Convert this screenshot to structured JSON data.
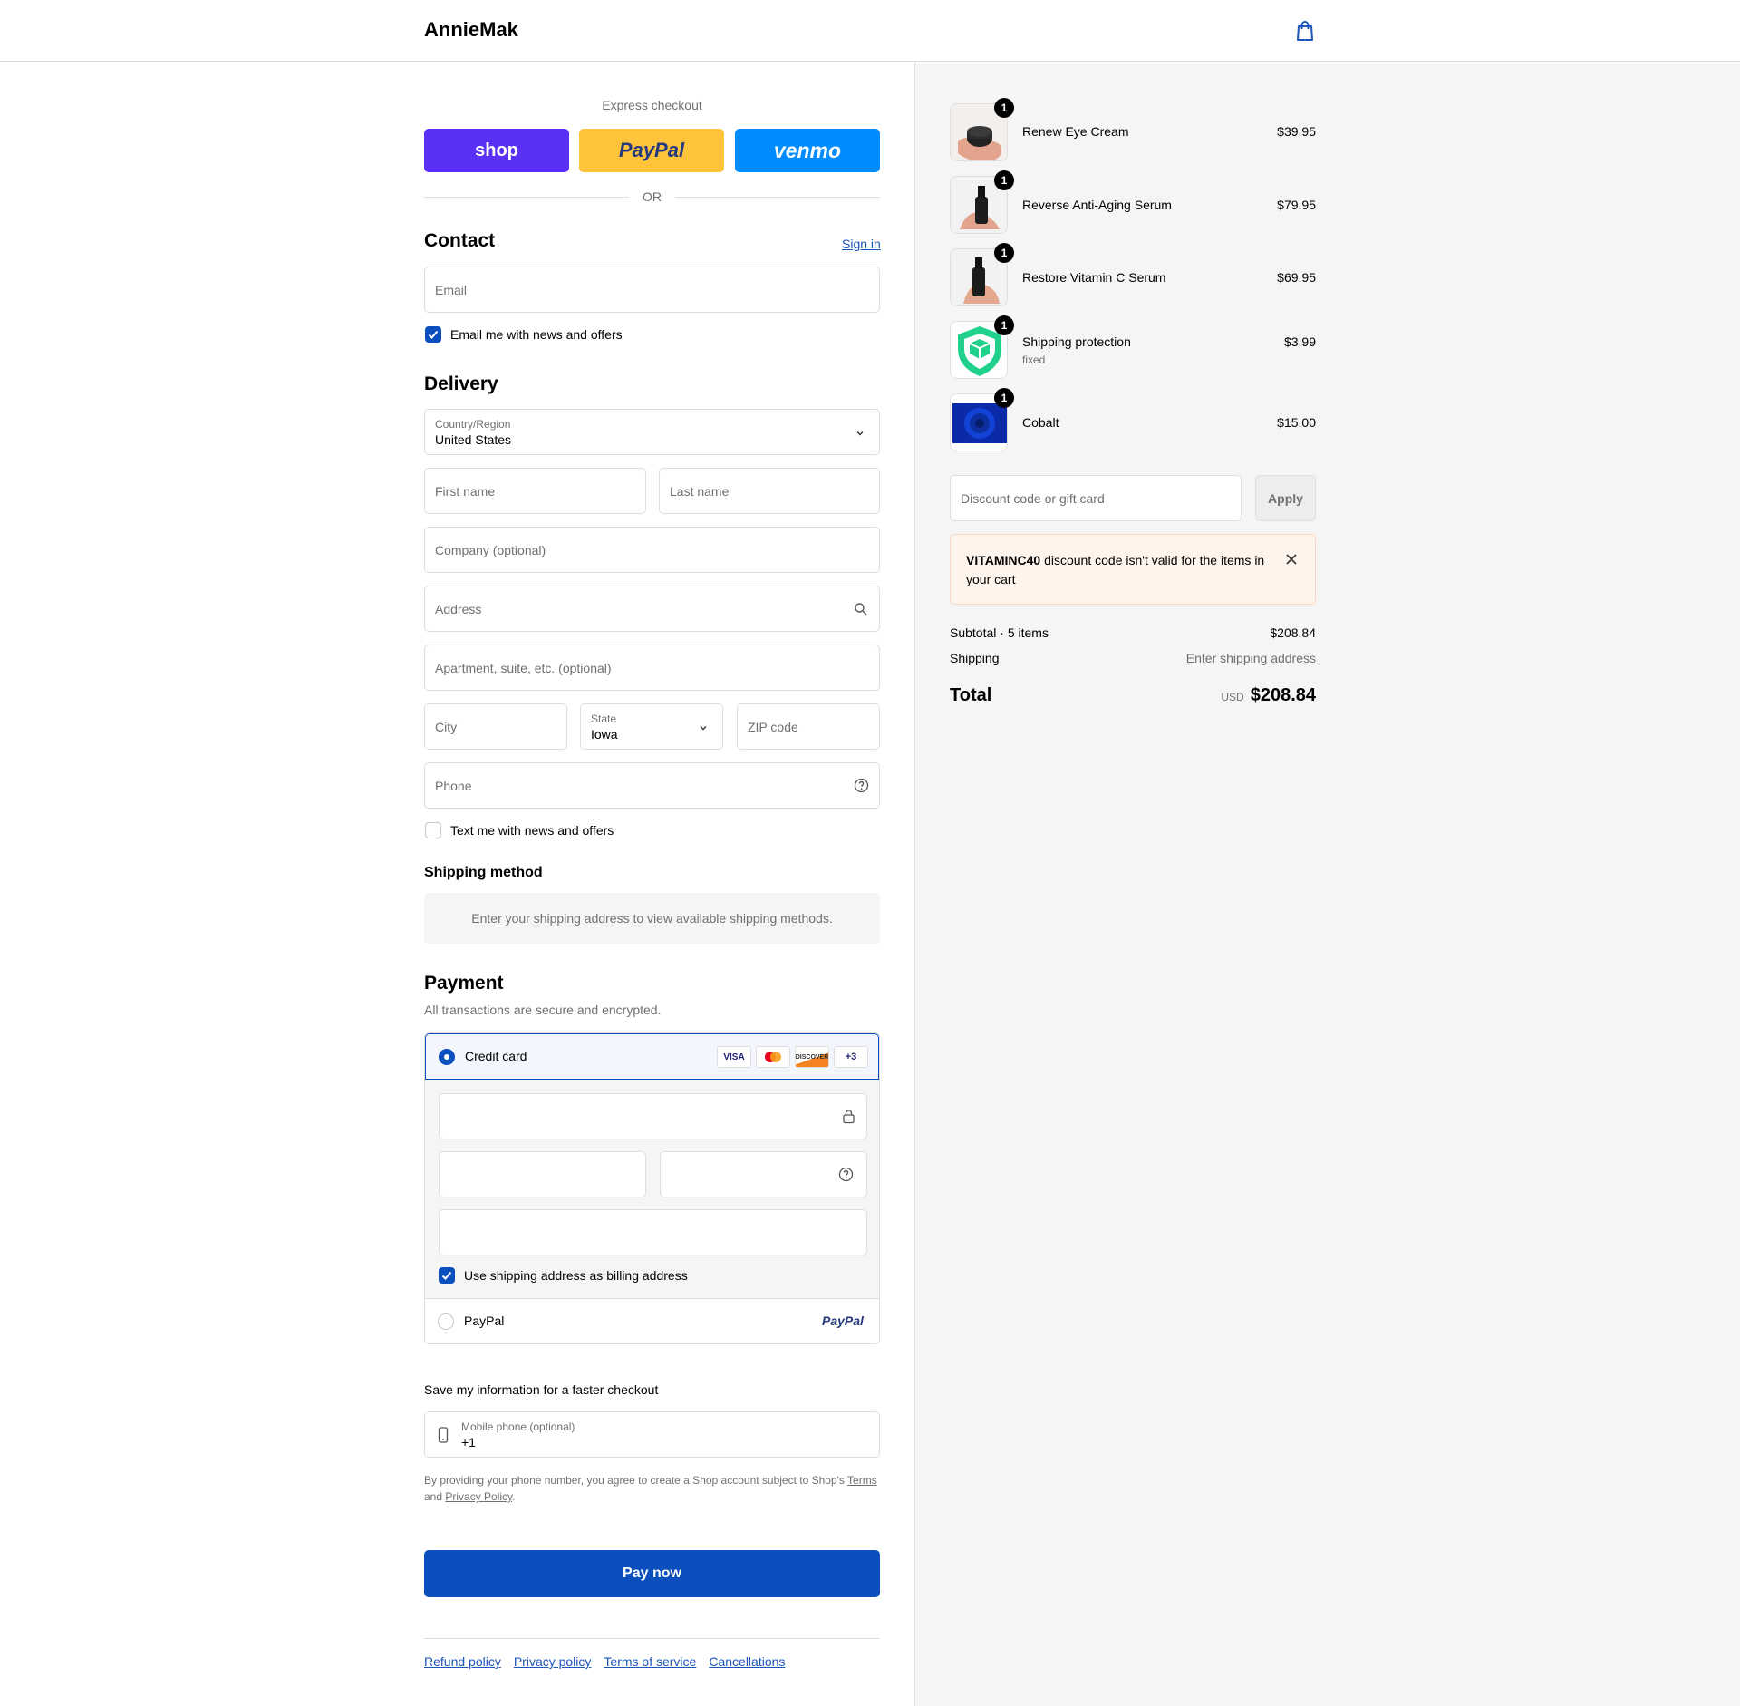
{
  "header": {
    "brand": "AnnieMak",
    "cart_icon": "shopping-bag-icon"
  },
  "express": {
    "title": "Express checkout",
    "shop_label": "shop",
    "paypal_label": "PayPal",
    "venmo_label": "venmo",
    "or_label": "OR",
    "colors": {
      "shop": "#5a31f4",
      "paypal": "#ffc439",
      "venmo": "#008cff"
    }
  },
  "contact": {
    "title": "Contact",
    "sign_in": "Sign in",
    "email_placeholder": "Email",
    "news_label": "Email me with news and offers",
    "news_checked": true
  },
  "delivery": {
    "title": "Delivery",
    "country_label": "Country/Region",
    "country_value": "United States",
    "first_name": "First name",
    "last_name": "Last name",
    "company": "Company (optional)",
    "address": "Address",
    "apartment": "Apartment, suite, etc. (optional)",
    "city": "City",
    "state_label": "State",
    "state_value": "Iowa",
    "zip": "ZIP code",
    "phone": "Phone",
    "text_label": "Text me with news and offers",
    "text_checked": false
  },
  "shipping_method": {
    "title": "Shipping method",
    "message": "Enter your shipping address to view available shipping methods."
  },
  "payment": {
    "title": "Payment",
    "subtitle": "All transactions are secure and encrypted.",
    "credit_card_label": "Credit card",
    "card_logos": [
      "VISA",
      "mastercard",
      "DISCOVER",
      "+3"
    ],
    "billing_label": "Use shipping address as billing address",
    "billing_checked": true,
    "paypal_label": "PayPal",
    "paypal_logo": "PayPal"
  },
  "save_info": {
    "title": "Save my information for a faster checkout",
    "mobile_label": "Mobile phone (optional)",
    "mobile_value": "+1",
    "legal_1": "By providing your phone number, you agree to create a Shop account subject to Shop's ",
    "terms": "Terms",
    "legal_2": "and ",
    "privacy": "Privacy Policy",
    "legal_3": "."
  },
  "pay_now": "Pay now",
  "footer": {
    "links": [
      "Refund policy",
      "Privacy policy",
      "Terms of service",
      "Cancellations"
    ]
  },
  "cart": {
    "items": [
      {
        "name": "Renew Eye Cream",
        "price": "$39.95",
        "qty": "1",
        "variant": ""
      },
      {
        "name": "Reverse Anti-Aging Serum",
        "price": "$79.95",
        "qty": "1",
        "variant": ""
      },
      {
        "name": "Restore Vitamin C Serum",
        "price": "$69.95",
        "qty": "1",
        "variant": ""
      },
      {
        "name": "Shipping protection",
        "price": "$3.99",
        "qty": "1",
        "variant": "fixed"
      },
      {
        "name": "Cobalt",
        "price": "$15.00",
        "qty": "1",
        "variant": ""
      }
    ],
    "discount_placeholder": "Discount code or gift card",
    "apply": "Apply",
    "error_code": "VITAMINC40",
    "error_text": " discount code isn't valid for the items in your cart",
    "subtotal_label": "Subtotal · 5 items",
    "subtotal_value": "$208.84",
    "shipping_label": "Shipping",
    "shipping_value": "Enter shipping address",
    "total_label": "Total",
    "currency": "USD",
    "total_value": "$208.84"
  }
}
